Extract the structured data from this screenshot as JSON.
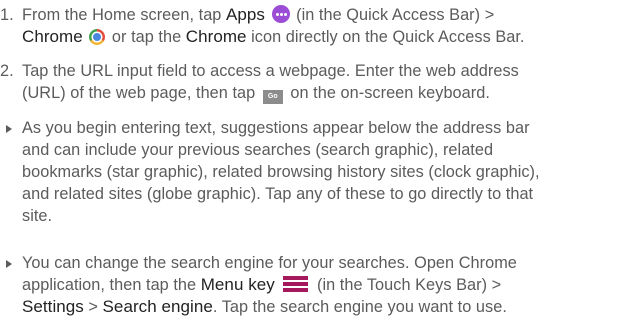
{
  "step1": {
    "number": "1.",
    "l1_a": "From the Home screen, tap ",
    "apps": "Apps",
    "l1_b": " (in the Quick Access Bar) >",
    "chrome1": "Chrome",
    "l2_b": " or tap the ",
    "chrome2": "Chrome",
    "l2_c": " icon directly on the Quick Access Bar."
  },
  "step2": {
    "number": "2.",
    "l1": "Tap the URL input field to access a webpage. Enter the web address",
    "l2_a": "(URL) of the web page, then tap ",
    "go_key": "Go",
    "l2_b": " on the on-screen keyboard."
  },
  "bullet1": {
    "lines": [
      "As you begin entering text, suggestions appear below the address bar",
      "and can include your previous searches (search graphic), related",
      "bookmarks (star graphic), related browsing history sites (clock graphic),",
      "and related sites (globe graphic). Tap any of these to go directly to that",
      "site."
    ]
  },
  "bullet2": {
    "l1": "You can change the search engine for your searches. Open Chrome",
    "l2_a": "application, then tap the ",
    "menu_key": "Menu key",
    "l2_b": " (in the Touch Keys Bar) >",
    "settings": "Settings",
    "sep": " > ",
    "search_engine": "Search engine",
    "l3_b": ". Tap the search engine you want to use."
  },
  "colors": {
    "text": "#5b5b5b",
    "emphasis": "#222222",
    "menu_icon": "#a3195b",
    "apps_icon": "#9b4dd6"
  },
  "icons": [
    "apps-icon",
    "chrome-icon",
    "go-key-icon",
    "menu-key-icon"
  ]
}
